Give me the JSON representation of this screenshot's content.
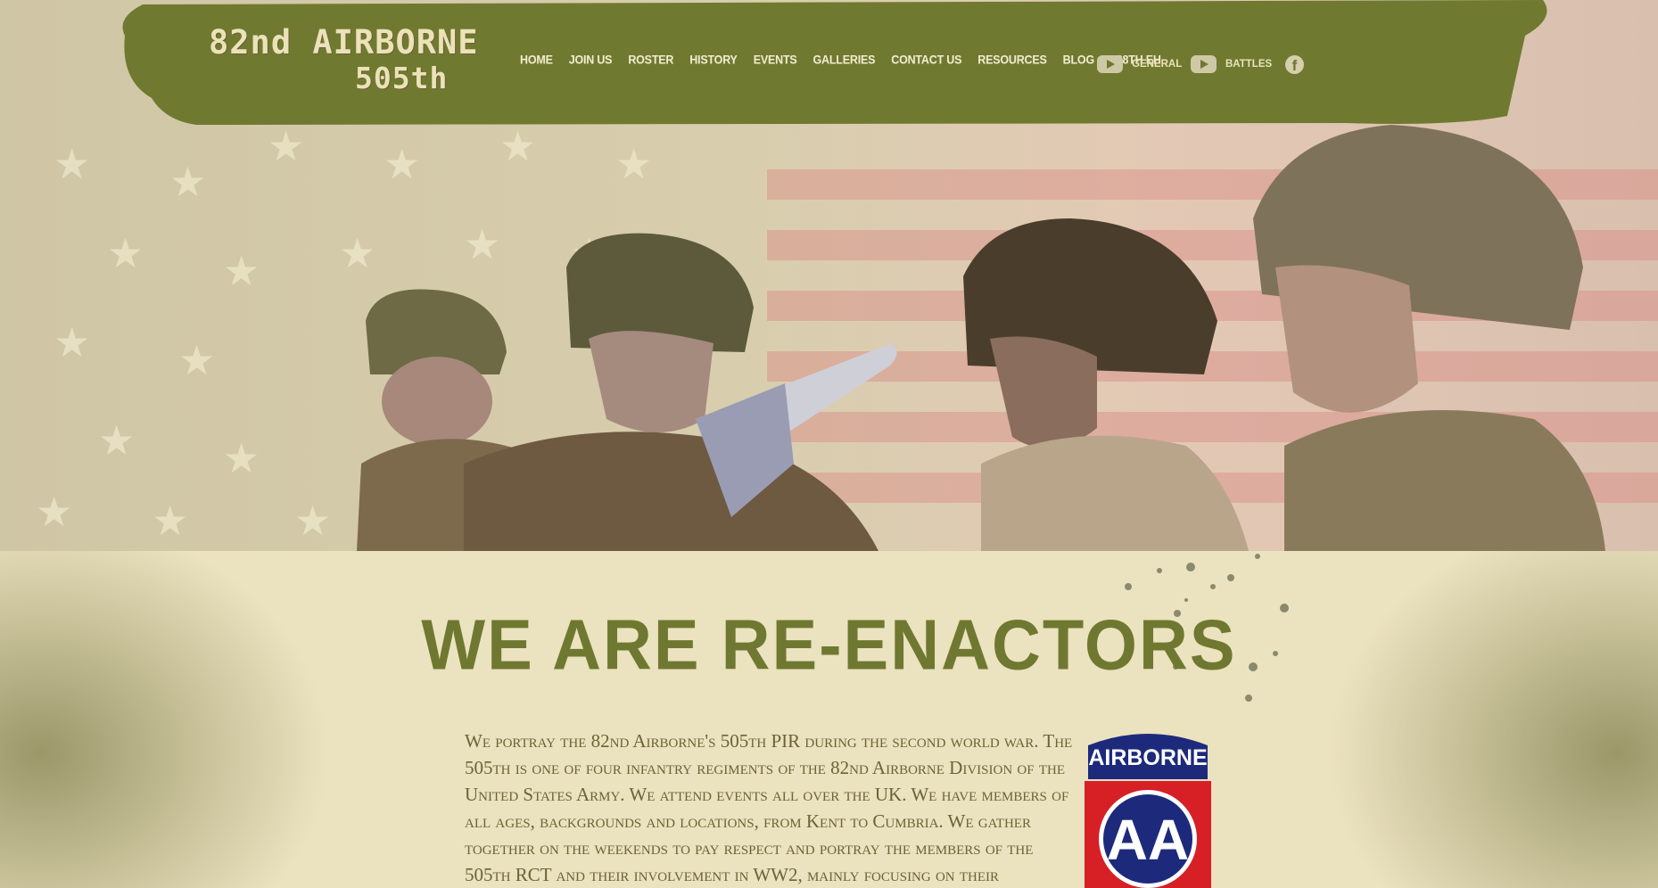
{
  "site": {
    "logo_line1": "82nd AIRBORNE",
    "logo_line2": "505th"
  },
  "nav": {
    "items": [
      {
        "label": "Home"
      },
      {
        "label": "Join Us"
      },
      {
        "label": "Roster"
      },
      {
        "label": "History"
      },
      {
        "label": "Events"
      },
      {
        "label": "Galleries"
      },
      {
        "label": "Contact Us"
      },
      {
        "label": "Resources"
      },
      {
        "label": "Blog"
      },
      {
        "label": "128th EH"
      }
    ],
    "youtube_general": "General",
    "youtube_battles": "Battles",
    "facebook_icon": "facebook-icon"
  },
  "main": {
    "headline": "We Are Re-Enactors",
    "about": "We portray the 82nd Airborne's 505th PIR during the second world war. The 505th is one of four infantry regiments of the 82nd Airborne Division of the United States Army. We attend events all over the UK. We have members of all ages, backgrounds and locations, from Kent to Cumbria. We gather together on the weekends to pay respect and portray the members of the 505th RCT and their involvement in WW2, mainly focusing on their",
    "badge": {
      "tab_text": "AIRBORNE",
      "monogram": "AA"
    }
  },
  "colors": {
    "olive": "#6f7830",
    "cream": "#ebe2bf",
    "badge_blue": "#1d2a7c",
    "badge_red": "#d71f26"
  }
}
